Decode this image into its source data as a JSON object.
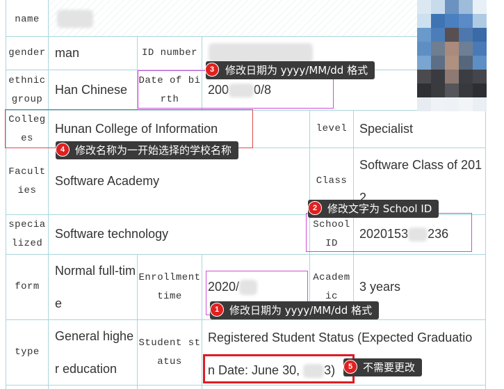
{
  "rows": {
    "name": {
      "label": "name"
    },
    "gender": {
      "label": "gender",
      "value": "man",
      "id_label": "ID number"
    },
    "ethnic": {
      "label": "ethnic group",
      "value": "Han Chinese",
      "dob_label": "Date of birth",
      "dob_value_a": "200",
      "dob_value_b": "0/8"
    },
    "college": {
      "label": "Colleges",
      "value": "Hunan College of Information",
      "level_label": "level",
      "level_value": "Specialist"
    },
    "faculty": {
      "label": "Faculties",
      "value": "Software Academy",
      "class_label": "Class",
      "class_value": "Software Class of 2012"
    },
    "specialized": {
      "label": "specialized",
      "value": "Software technology",
      "school_label": "School ID",
      "school_value_a": "2020153",
      "school_value_b": "236"
    },
    "form": {
      "label": "form",
      "value": "Normal full-time",
      "enroll_label": "Enrollment time",
      "enroll_value": "2020/",
      "academic_label": "Academic",
      "academic_value": "3 years"
    },
    "type": {
      "label": "type",
      "value": "General higher education",
      "status_label": "Student status",
      "status_value_line1": "Registered Student Status (Expected Graduatio",
      "status_value_line2": "n Date: June 30, ",
      "status_value_tail": "3)"
    }
  },
  "annotations": [
    {
      "num": "1",
      "text": "修改日期为 yyyy/MM/dd 格式"
    },
    {
      "num": "2",
      "text": "修改文字为 School ID"
    },
    {
      "num": "3",
      "text": "修改日期为 yyyy/MM/dd 格式"
    },
    {
      "num": "4",
      "text": "修改名称为一开始选择的学校名称"
    },
    {
      "num": "5",
      "text": "不需要更改"
    }
  ],
  "colors": {
    "grid": "#a9d6dc",
    "red_box": "#e0474c",
    "magenta_box": "#d14bd6",
    "tip_bg": "#3a3a3a",
    "badge": "#e02020"
  }
}
